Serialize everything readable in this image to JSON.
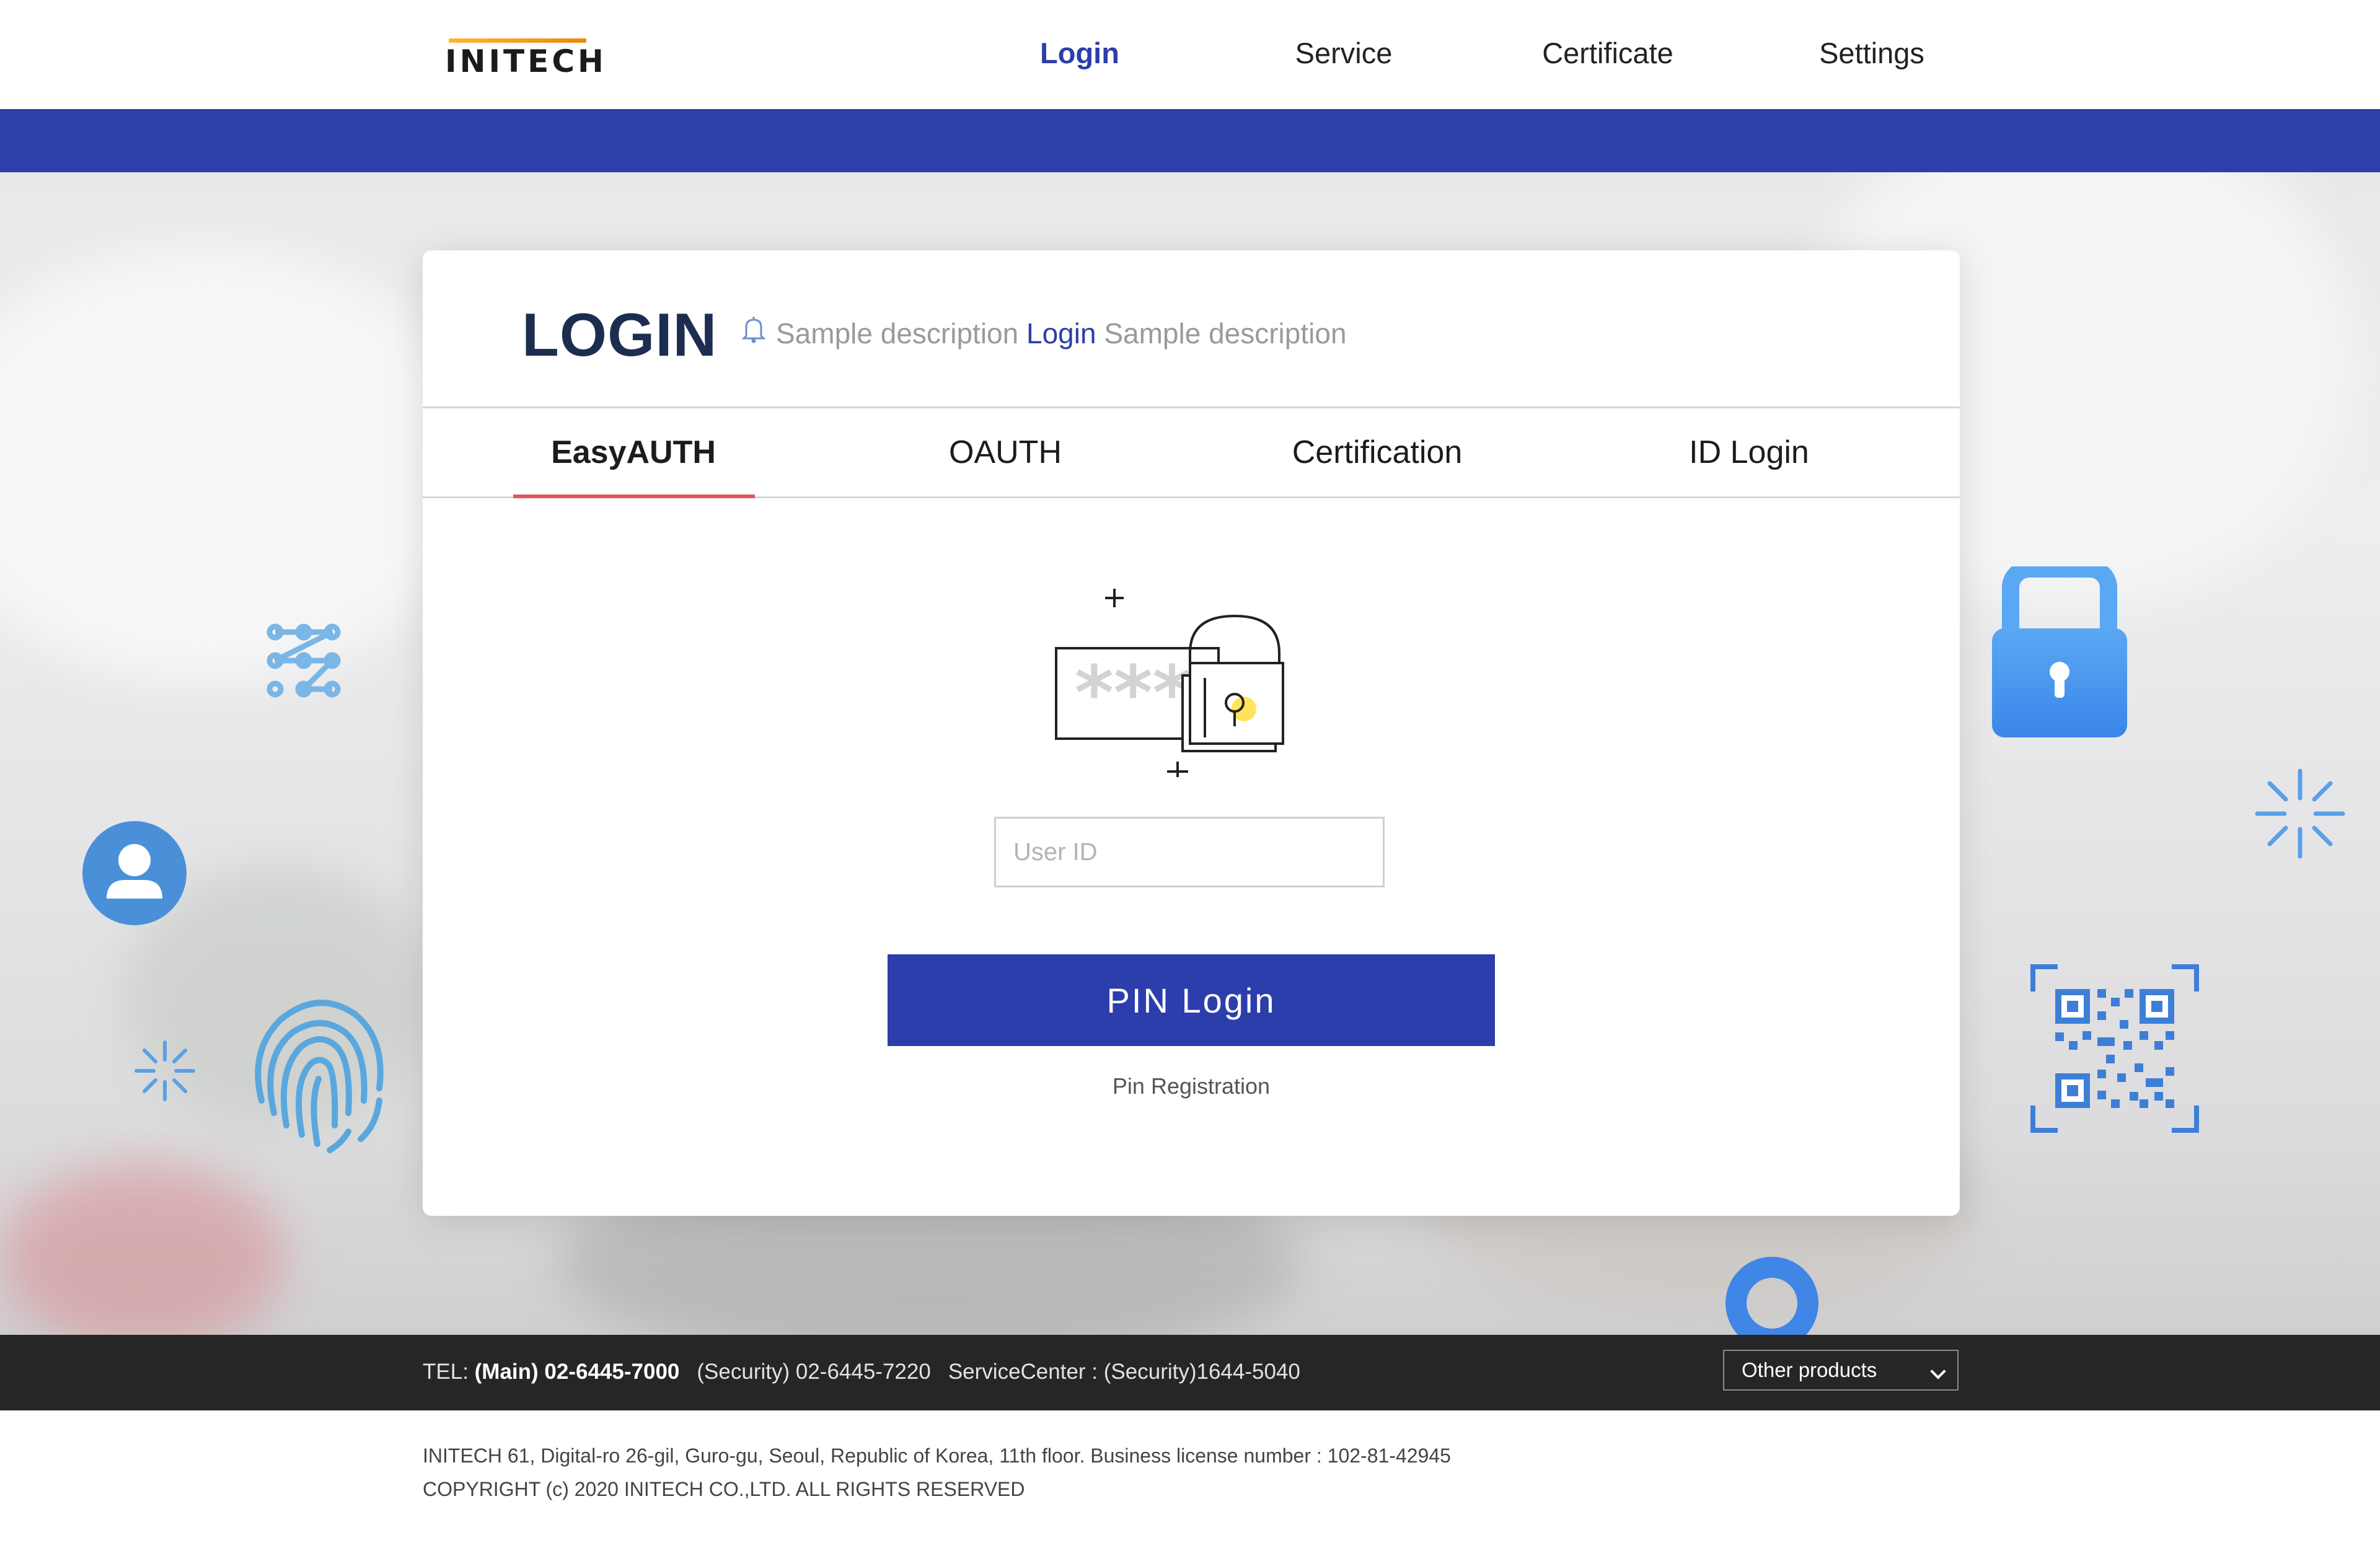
{
  "header": {
    "logo_text": "INITECH",
    "nav": [
      {
        "label": "Login",
        "active": true
      },
      {
        "label": "Service",
        "active": false
      },
      {
        "label": "Certificate",
        "active": false
      },
      {
        "label": "Settings",
        "active": false
      }
    ]
  },
  "login": {
    "title": "LOGIN",
    "desc_prefix": "Sample description",
    "desc_highlight": "Login",
    "desc_suffix": "Sample description",
    "tabs": [
      {
        "label": "EasyAUTH",
        "active": true
      },
      {
        "label": "OAUTH",
        "active": false
      },
      {
        "label": "Certification",
        "active": false
      },
      {
        "label": "ID Login",
        "active": false
      }
    ],
    "illustration_mask": "***",
    "userid_placeholder": "User ID",
    "userid_value": "",
    "pin_button": "PIN Login",
    "pin_registration": "Pin Registration"
  },
  "footer": {
    "tel_label": "TEL:",
    "tel_main": "(Main) 02-6445-7000",
    "tel_security": "(Security) 02-6445-7220",
    "service_center": "ServiceCenter : (Security)1644-5040",
    "products_select": "Other products",
    "address": "INITECH 61, Digital-ro 26-gil, Guro-gu, Seoul, Republic of Korea, 11th floor. Business license number : 102-81-42945",
    "copyright": "COPYRIGHT (c) 2020 INITECH CO.,LTD. ALL RIGHTS RESERVED"
  },
  "colors": {
    "brand_blue": "#2c3eab",
    "tab_underline": "#e2545b",
    "icon_blue": "#4a90e2",
    "footer_bg": "#262626"
  },
  "icons": [
    "bell-icon",
    "password-lock-icon",
    "user-avatar-icon",
    "fingerprint-icon",
    "pattern-icon",
    "sparkle-icon",
    "padlock-icon",
    "qr-code-icon",
    "ring-icon",
    "chevron-down-icon"
  ]
}
